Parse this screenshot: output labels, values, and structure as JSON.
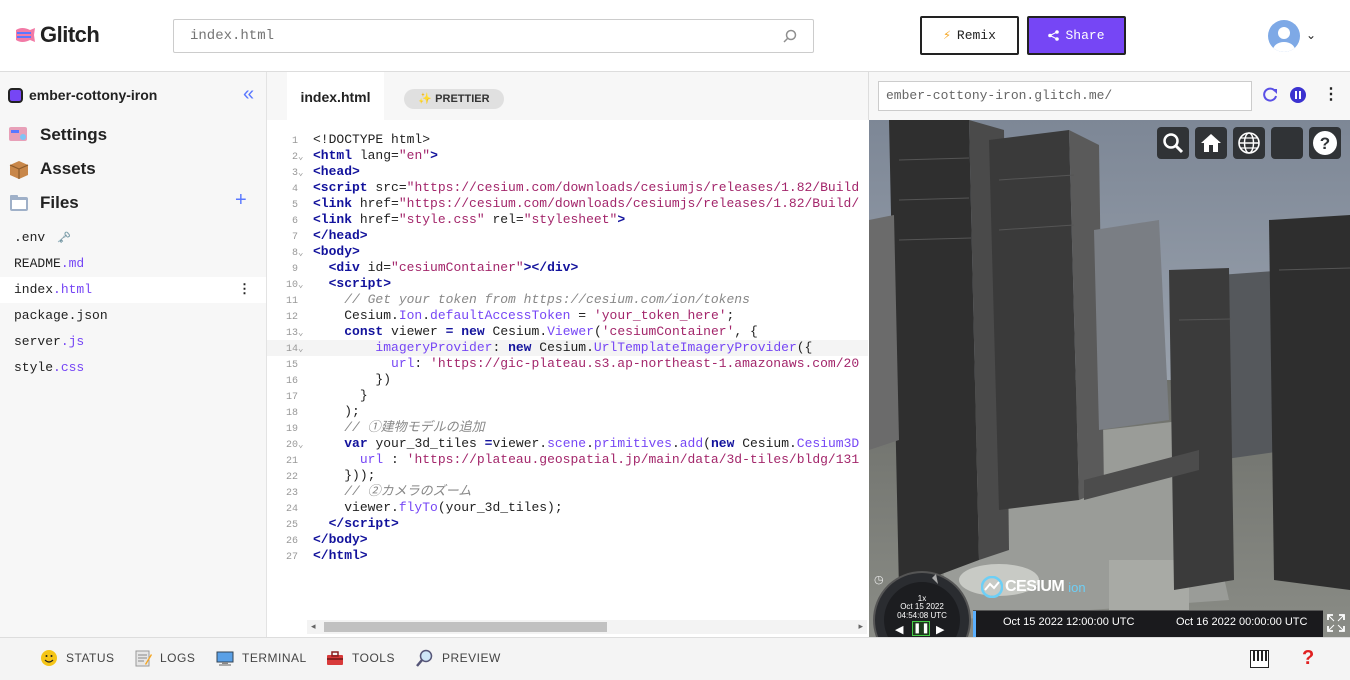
{
  "header": {
    "logo_text": "Glitch",
    "search_placeholder": "index.html",
    "remix_label": "Remix",
    "share_label": "Share"
  },
  "sidebar": {
    "project_name": "ember-cottony-iron",
    "sections": {
      "settings": "Settings",
      "assets": "Assets",
      "files": "Files"
    },
    "files": [
      {
        "name": ".env",
        "ext": "",
        "extra": "🗝️"
      },
      {
        "name": "README",
        "ext": ".md"
      },
      {
        "name": "index",
        "ext": ".html"
      },
      {
        "name": "package.json",
        "ext": ""
      },
      {
        "name": "server",
        "ext": ".js"
      },
      {
        "name": "style",
        "ext": ".css"
      }
    ]
  },
  "editor": {
    "tab_label": "index.html",
    "prettier_label": "✨ PRETTIER",
    "lines": [
      "1",
      "2",
      "3",
      "4",
      "5",
      "6",
      "7",
      "8",
      "9",
      "10",
      "11",
      "12",
      "13",
      "14",
      "15",
      "16",
      "17",
      "18",
      "19",
      "20",
      "21",
      "22",
      "23",
      "24",
      "25",
      "26",
      "27"
    ]
  },
  "preview": {
    "url": "ember-cottony-iron.glitch.me/",
    "cesium_logo": "CESIUM",
    "cesium_logo_sub": "ion",
    "clock_speed": "1x",
    "clock_date": "Oct 15 2022",
    "clock_time": "04:54:08 UTC",
    "timeline_left": "Oct 15 2022 12:00:00 UTC",
    "timeline_right": "Oct 16 2022 00:00:00 UTC"
  },
  "bottombar": {
    "status": "STATUS",
    "logs": "LOGS",
    "terminal": "TERMINAL",
    "tools": "TOOLS",
    "preview": "PREVIEW"
  },
  "colors": {
    "accent": "#7646f5",
    "link_blue": "#5a78ff",
    "help_red": "#e02020"
  }
}
